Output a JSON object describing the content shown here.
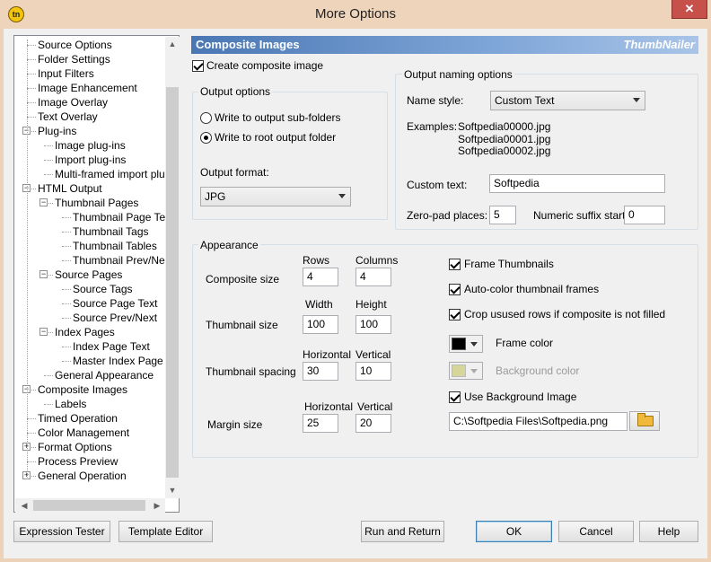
{
  "window": {
    "title": "More Options",
    "close": "✕",
    "icon": "tn"
  },
  "tree": {
    "items": [
      {
        "label": "Source Options",
        "level": 1
      },
      {
        "label": "Folder Settings",
        "level": 1
      },
      {
        "label": "Input Filters",
        "level": 1
      },
      {
        "label": "Image Enhancement",
        "level": 1
      },
      {
        "label": "Image Overlay",
        "level": 1
      },
      {
        "label": "Text Overlay",
        "level": 1
      },
      {
        "label": "Plug-ins",
        "level": 1
      },
      {
        "label": "Image plug-ins",
        "level": 2
      },
      {
        "label": "Import plug-ins",
        "level": 2
      },
      {
        "label": "Multi-framed import plug-i",
        "level": 2
      },
      {
        "label": "HTML Output",
        "level": 1
      },
      {
        "label": "Thumbnail Pages",
        "level": 2
      },
      {
        "label": "Thumbnail Page Text",
        "level": 3
      },
      {
        "label": "Thumbnail Tags",
        "level": 3
      },
      {
        "label": "Thumbnail Tables",
        "level": 3
      },
      {
        "label": "Thumbnail Prev/Next",
        "level": 3
      },
      {
        "label": "Source Pages",
        "level": 2
      },
      {
        "label": "Source Tags",
        "level": 3
      },
      {
        "label": "Source Page Text",
        "level": 3
      },
      {
        "label": "Source Prev/Next",
        "level": 3
      },
      {
        "label": "Index Pages",
        "level": 2
      },
      {
        "label": "Index Page Text",
        "level": 3
      },
      {
        "label": "Master Index Page",
        "level": 3
      },
      {
        "label": "General Appearance",
        "level": 2
      },
      {
        "label": "Composite Images",
        "level": 1
      },
      {
        "label": "Labels",
        "level": 2
      },
      {
        "label": "Timed Operation",
        "level": 1
      },
      {
        "label": "Color Management",
        "level": 1
      },
      {
        "label": "Format Options",
        "level": 1
      },
      {
        "label": "Process Preview",
        "level": 1
      },
      {
        "label": "General Operation",
        "level": 1
      }
    ]
  },
  "panel": {
    "title": "Composite Images",
    "app_name": "ThumbNailer",
    "create_composite": "Create composite image",
    "output_options": {
      "title": "Output options",
      "sub_folders": "Write to output sub-folders",
      "root_folder": "Write to root output folder",
      "format_label": "Output format:",
      "format_value": "JPG"
    },
    "naming": {
      "title": "Output naming options",
      "style_label": "Name style:",
      "style_value": "Custom Text",
      "examples_label": "Examples:",
      "examples": [
        "Softpedia00000.jpg",
        "Softpedia00001.jpg",
        "Softpedia00002.jpg"
      ],
      "custom_text_label": "Custom text:",
      "custom_text_value": "Softpedia",
      "zeropad_label": "Zero-pad places:",
      "zeropad_value": "5",
      "suffix_label": "Numeric suffix start:",
      "suffix_value": "0"
    },
    "appearance": {
      "title": "Appearance",
      "composite_size": {
        "label": "Composite size",
        "col1": "Rows",
        "col2": "Columns",
        "v1": "4",
        "v2": "4"
      },
      "thumbnail_size": {
        "label": "Thumbnail size",
        "col1": "Width",
        "col2": "Height",
        "v1": "100",
        "v2": "100"
      },
      "thumbnail_spacing": {
        "label": "Thumbnail spacing",
        "col1": "Horizontal",
        "col2": "Vertical",
        "v1": "30",
        "v2": "10"
      },
      "margin_size": {
        "label": "Margin size",
        "col1": "Horizontal",
        "col2": "Vertical",
        "v1": "25",
        "v2": "20"
      },
      "frame_thumbnails": "Frame Thumbnails",
      "auto_color": "Auto-color thumbnail frames",
      "crop_rows": "Crop usused rows if composite is not filled",
      "frame_color": "Frame color",
      "background_color": "Background color",
      "use_bg_image": "Use Background Image",
      "bg_image_path": "C:\\Softpedia Files\\Softpedia.png",
      "frame_color_hex": "#000000",
      "bg_color_hex": "#d6d69a"
    }
  },
  "buttons": {
    "expression_tester": "Expression Tester",
    "template_editor": "Template Editor",
    "run_and_return": "Run and Return",
    "ok": "OK",
    "cancel": "Cancel",
    "help": "Help"
  }
}
